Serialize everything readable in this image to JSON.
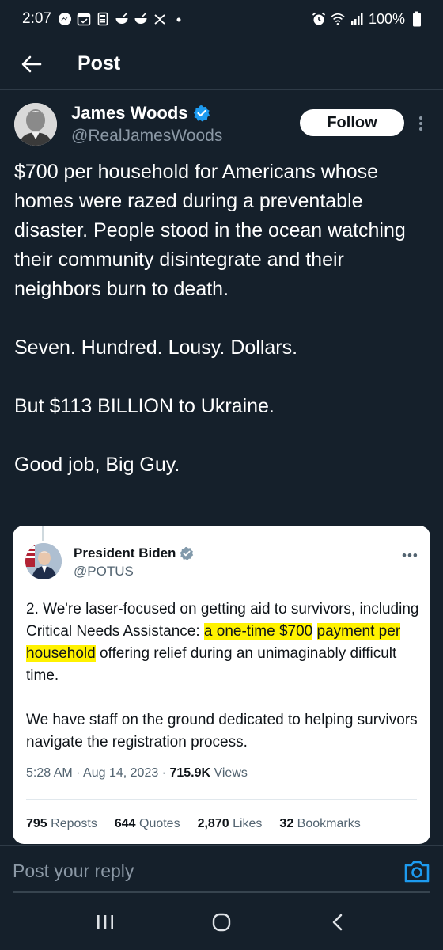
{
  "status_bar": {
    "time": "2:07",
    "battery": "100%"
  },
  "header": {
    "title": "Post"
  },
  "author": {
    "name": "James Woods",
    "handle": "@RealJamesWoods",
    "follow_label": "Follow",
    "verified": true
  },
  "tweet": {
    "paragraphs": [
      "$700 per household for Americans whose homes were razed during a preventable disaster. People stood in the ocean watching their community disintegrate and their neighbors burn to death.",
      "Seven. Hundred. Lousy. Dollars.",
      "But $113 BILLION to Ukraine.",
      "Good job, Big Guy."
    ]
  },
  "quoted": {
    "name": "President Biden",
    "handle": "@POTUS",
    "more": "•••",
    "text_1_pre": "2. We're laser-focused on getting aid to survivors, including Critical Needs Assistance: ",
    "text_1_hl_a": "a one-time $700",
    "text_1_hl_b": "payment per household",
    "text_1_post": " offering relief during an unimaginably difficult time.",
    "text_2": "We have staff on the ground dedicated to helping survivors navigate the registration process.",
    "meta_time": "5:28 AM · Aug 14, 2023 · ",
    "views_count": "715.9K",
    "views_label": " Views",
    "stats": [
      {
        "count": "795",
        "label": " Reposts"
      },
      {
        "count": "644",
        "label": " Quotes"
      },
      {
        "count": "2,870",
        "label": " Likes"
      },
      {
        "count": "32",
        "label": " Bookmarks"
      }
    ]
  },
  "reply": {
    "placeholder": "Post your reply"
  },
  "colors": {
    "background": "#15202b",
    "verified_blue": "#1d9bf0",
    "highlight": "#fff200"
  }
}
